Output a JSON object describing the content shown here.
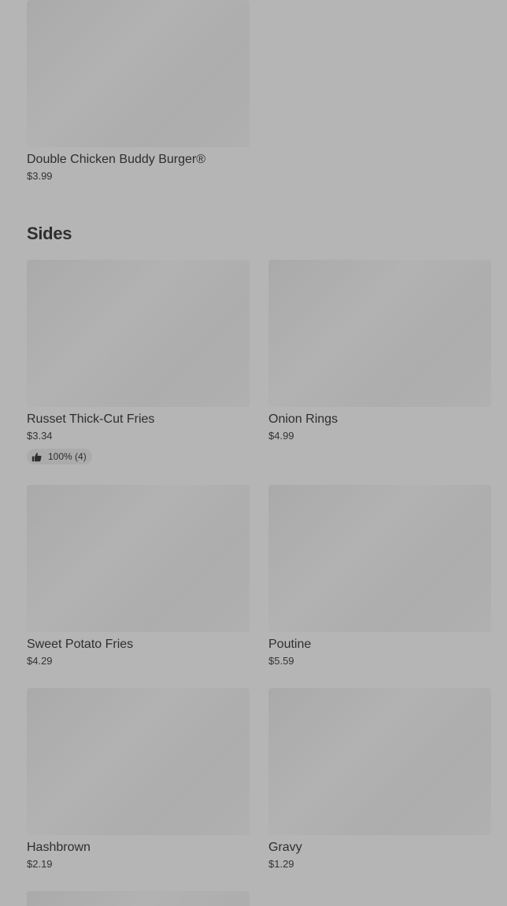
{
  "top_item": {
    "name": "Double Chicken Buddy Burger®",
    "price": "$3.99"
  },
  "sides": {
    "title": "Sides",
    "items": [
      {
        "name": "Russet Thick-Cut Fries",
        "price": "$3.34",
        "rating": "100% (4)",
        "rating_icon": "thumbs-up-icon"
      },
      {
        "name": "Onion Rings",
        "price": "$4.99"
      },
      {
        "name": "Sweet Potato Fries",
        "price": "$4.29"
      },
      {
        "name": "Poutine",
        "price": "$5.59"
      },
      {
        "name": "Hashbrown",
        "price": "$2.19"
      },
      {
        "name": "Gravy",
        "price": "$1.29"
      }
    ]
  }
}
